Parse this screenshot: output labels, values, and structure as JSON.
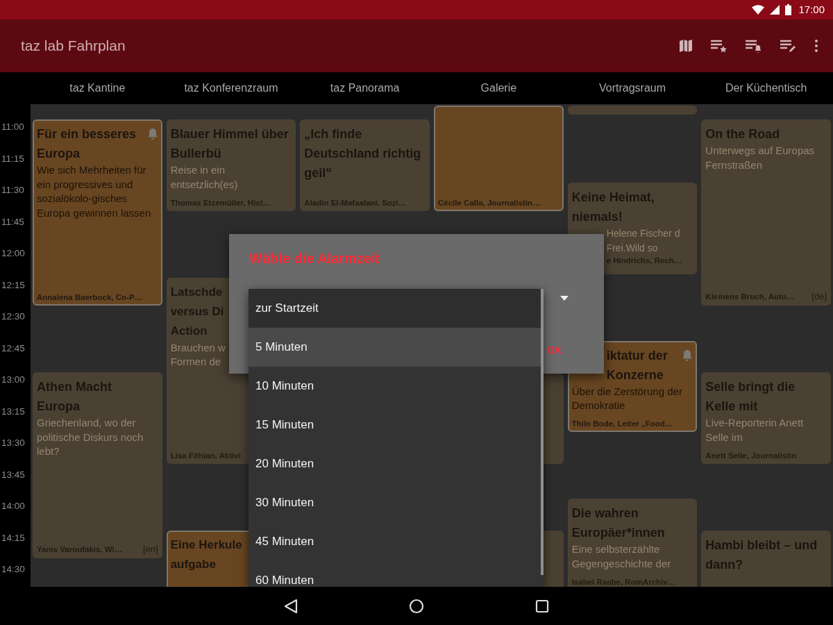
{
  "status_bar": {
    "time": "17:00"
  },
  "app_bar": {
    "title": "taz lab Fahrplan"
  },
  "columns": [
    {
      "name": "taz Kantine",
      "events": [
        {
          "title": "Für ein besseres Europa",
          "subtitle": "Wie sich Mehrheiten für ein progressives und sozialökolo-gisches Europa gewinnen lassen",
          "speaker": "Annalena Baerbock, Co-P…",
          "favorite": true,
          "alarm": true
        },
        {
          "title": "Athen Macht Europa",
          "subtitle": "Griechenland, wo der politische Diskurs noch lebt?",
          "speaker": "Yanis Varoufakis, Wi…",
          "lang": "[en]",
          "favorite": false,
          "alarm": false
        }
      ]
    },
    {
      "name": "taz Konferenzraum",
      "events": [
        {
          "title": "Blauer Himmel über Bullerbü",
          "subtitle": "Reise in ein entsetzlich(es)",
          "speaker": "Thomas Etzemüller, Hist…",
          "favorite": false,
          "alarm": false
        },
        {
          "title": "Latschde versus Di Action",
          "subtitle": "Brauchen w Formen de",
          "speaker": "Lisa Fithian, Aktivi",
          "favorite": false,
          "alarm": false
        },
        {
          "title": "Eine Herkule aufgabe",
          "favorite": true,
          "alarm": false
        }
      ]
    },
    {
      "name": "taz Panorama",
      "events": [
        {
          "title": "„Ich finde Deutschland richtig geil“",
          "speaker": "Aladin El-Mafaalani, Sozi…",
          "favorite": false,
          "alarm": false
        }
      ]
    },
    {
      "name": "Galerie",
      "events": [
        {
          "speaker": "Cécile Calla, Journalistin…",
          "favorite": true,
          "alarm": false
        },
        {
          "favorite": false
        },
        {
          "favorite": false
        }
      ]
    },
    {
      "name": "Vortragsraum",
      "events": [
        {
          "favorite": false
        },
        {
          "title": "Keine Heimat, niemals!",
          "subtitle": "Helene Fischer d Frei.Wild so",
          "speaker": "e Hindrichs, Rech…",
          "favorite": false,
          "alarm": false
        },
        {
          "title": "iktatur der Konzerne",
          "subtitle": "Über die Zerstörung der Demokratie",
          "speaker": "Thilo Bode, Leiter „Food…",
          "favorite": true,
          "alarm": true
        },
        {
          "title": "Die wahren Europäer*innen",
          "subtitle": "Eine selbsterzählte Gegengeschichte der",
          "speaker": "Isabel Raabe, RomArchiv…",
          "favorite": false,
          "alarm": false
        }
      ]
    },
    {
      "name": "Der Küchentisch",
      "events": [
        {
          "title": "On the Road",
          "subtitle": "Unterwegs auf Europas Fernstraßen",
          "speaker": "Klemens Bruch, Auto…",
          "lang": "[de]",
          "favorite": false,
          "alarm": false
        },
        {
          "title": "Selle bringt die Kelle mit",
          "subtitle": "Live-Reporterin Anett Selle im",
          "speaker": "Anett Selle, Journalistin",
          "favorite": false,
          "alarm": false
        },
        {
          "title": "Hambi bleibt – und dann?",
          "favorite": false,
          "alarm": false
        }
      ]
    }
  ],
  "times": [
    "11:00",
    "11:15",
    "11:30",
    "11:45",
    "12:00",
    "12:15",
    "12:30",
    "12:45",
    "13:00",
    "13:15",
    "13:30",
    "13:45",
    "14:00",
    "14:15",
    "14:30"
  ],
  "dialog": {
    "title": "Wähle die Alarmzeit",
    "ok": "OK",
    "options": [
      {
        "label": "zur Startzeit",
        "selected": false
      },
      {
        "label": "5 Minuten",
        "selected": true
      },
      {
        "label": "10 Minuten",
        "selected": false
      },
      {
        "label": "15 Minuten",
        "selected": false
      },
      {
        "label": "20 Minuten",
        "selected": false
      },
      {
        "label": "30 Minuten",
        "selected": false
      },
      {
        "label": "45 Minuten",
        "selected": false
      },
      {
        "label": "60 Minuten",
        "selected": false
      }
    ]
  }
}
